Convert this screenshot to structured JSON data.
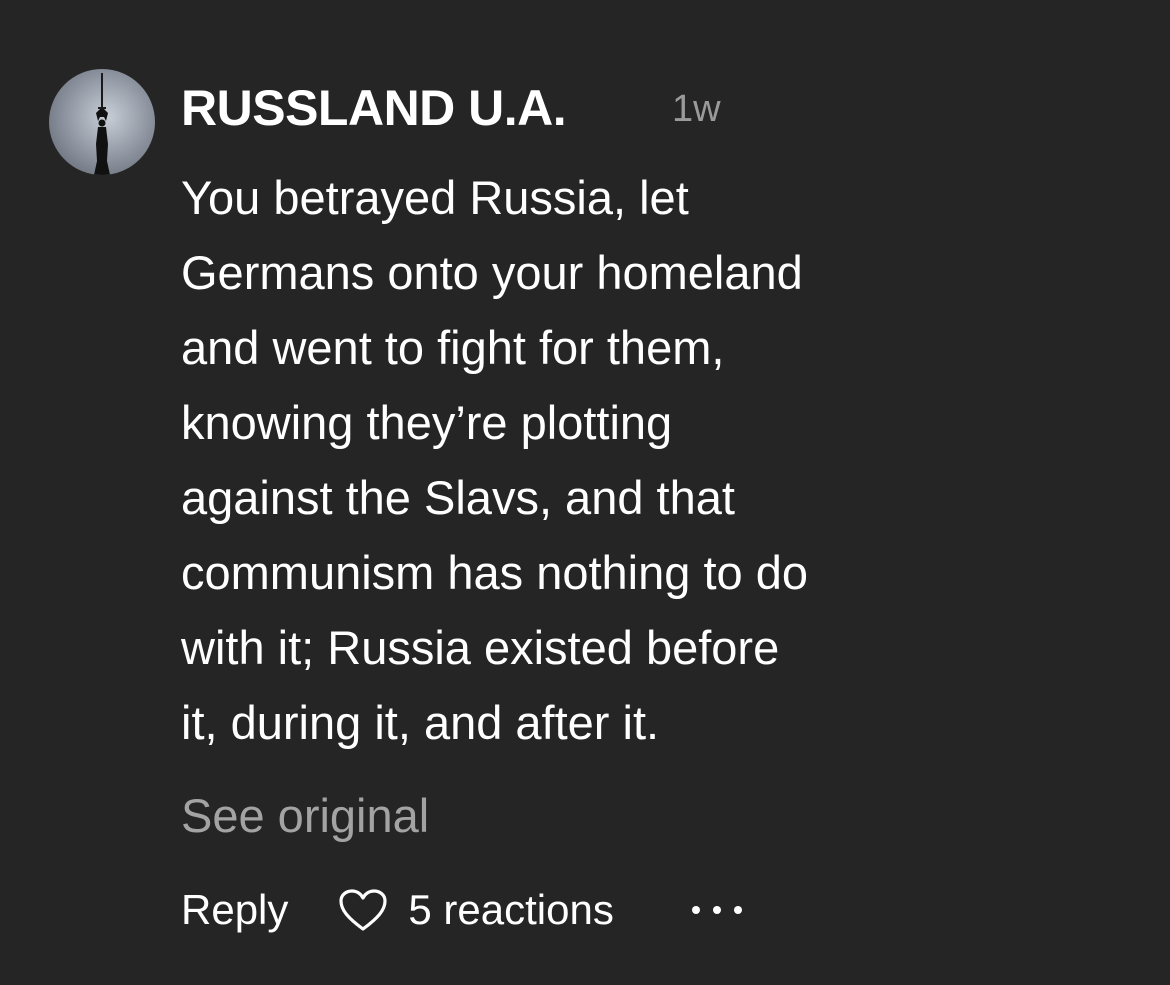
{
  "comment": {
    "username": "RUSSLAND U.A.",
    "timestamp": "1w",
    "avatar_icon": "statue-silhouette-icon",
    "body_lines": [
      "You betrayed Russia, let",
      "Germans onto your homeland",
      "and went to fight for them,",
      "knowing they’re plotting",
      "against the Slavs, and that",
      "communism has nothing to do",
      "with it; Russia existed before",
      "it, during it, and after it."
    ],
    "see_original_label": "See original"
  },
  "actions": {
    "reply_label": "Reply",
    "heart_icon": "heart-outline-icon",
    "reactions_label": "5 reactions",
    "more_icon": "more-dots-icon"
  },
  "colors": {
    "background": "#252525",
    "text": "#ffffff",
    "muted": "#9a9a9a"
  }
}
